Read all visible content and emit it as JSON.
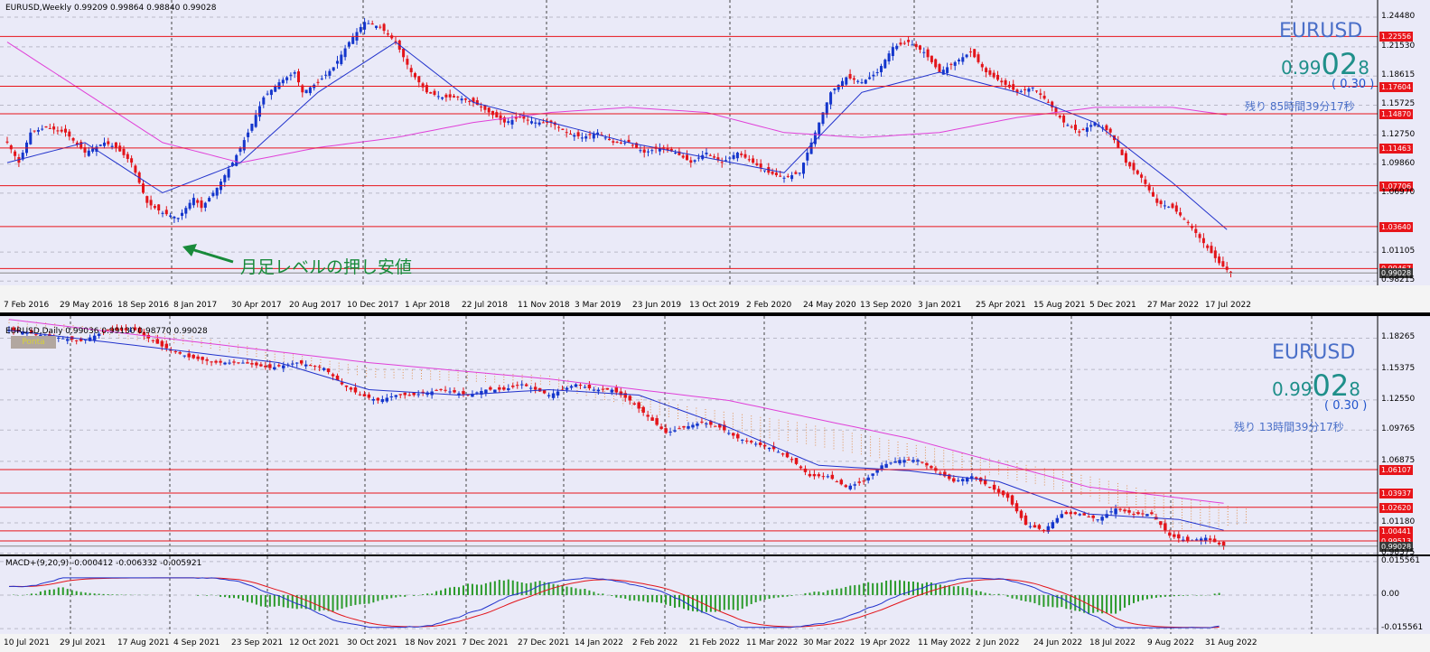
{
  "chart_data": [
    {
      "type": "candlestick",
      "header": "EURUSD,Weekly  0.99209 0.99864 0.98840 0.99028",
      "symbol": "EURUSD",
      "price": {
        "prefix": "0.99",
        "big": "02",
        "suffix": "8"
      },
      "change": "( 0.30 )",
      "remaining": "残り 85時間39分17秒",
      "annotation": "月足レベルの押し安値",
      "ylim": [
        0.9779,
        1.2619
      ],
      "yticks": [
        "1.24480",
        "1.21530",
        "1.18615",
        "1.15725",
        "1.12750",
        "1.09860",
        "1.06970",
        "1.01105",
        "0.98215"
      ],
      "hlines": [
        1.22556,
        1.17604,
        1.1487,
        1.11463,
        1.07706,
        1.0364,
        0.99467
      ],
      "hline_labels": [
        "1.22556",
        "1.17604",
        "1.14870",
        "1.11463",
        "1.07706",
        "1.03640",
        "0.99467"
      ],
      "current_label": "0.99028",
      "current": 0.99028,
      "xlabels": [
        "7 Feb 2016",
        "29 May 2016",
        "18 Sep 2016",
        "8 Jan 2017",
        "30 Apr 2017",
        "20 Aug 2017",
        "10 Dec 2017",
        "1 Apr 2018",
        "22 Jul 2018",
        "11 Nov 2018",
        "3 Mar 2019",
        "23 Jun 2019",
        "13 Oct 2019",
        "2 Feb 2020",
        "24 May 2020",
        "13 Sep 2020",
        "3 Jan 2021",
        "25 Apr 2021",
        "15 Aug 2021",
        "5 Dec 2021",
        "27 Mar 2022",
        "17 Jul 2022"
      ],
      "price_path": [
        [
          0,
          1.12
        ],
        [
          3,
          1.1
        ],
        [
          6,
          1.13
        ],
        [
          10,
          1.135
        ],
        [
          15,
          1.13
        ],
        [
          20,
          1.11
        ],
        [
          25,
          1.12
        ],
        [
          28,
          1.115
        ],
        [
          32,
          1.1
        ],
        [
          36,
          1.06
        ],
        [
          40,
          1.05
        ],
        [
          44,
          1.045
        ],
        [
          48,
          1.065
        ],
        [
          50,
          1.055
        ],
        [
          54,
          1.075
        ],
        [
          58,
          1.1
        ],
        [
          62,
          1.13
        ],
        [
          66,
          1.165
        ],
        [
          70,
          1.18
        ],
        [
          74,
          1.19
        ],
        [
          76,
          1.17
        ],
        [
          80,
          1.18
        ],
        [
          84,
          1.195
        ],
        [
          88,
          1.22
        ],
        [
          92,
          1.24
        ],
        [
          96,
          1.235
        ],
        [
          100,
          1.22
        ],
        [
          104,
          1.19
        ],
        [
          108,
          1.17
        ],
        [
          112,
          1.165
        ],
        [
          116,
          1.165
        ],
        [
          120,
          1.16
        ],
        [
          124,
          1.15
        ],
        [
          128,
          1.14
        ],
        [
          132,
          1.145
        ],
        [
          136,
          1.14
        ],
        [
          140,
          1.14
        ],
        [
          144,
          1.13
        ],
        [
          148,
          1.125
        ],
        [
          152,
          1.13
        ],
        [
          156,
          1.12
        ],
        [
          160,
          1.12
        ],
        [
          164,
          1.11
        ],
        [
          168,
          1.115
        ],
        [
          172,
          1.11
        ],
        [
          176,
          1.1
        ],
        [
          180,
          1.11
        ],
        [
          184,
          1.1
        ],
        [
          188,
          1.11
        ],
        [
          192,
          1.1
        ],
        [
          196,
          1.09
        ],
        [
          200,
          1.085
        ],
        [
          204,
          1.09
        ],
        [
          208,
          1.13
        ],
        [
          212,
          1.17
        ],
        [
          216,
          1.185
        ],
        [
          220,
          1.18
        ],
        [
          224,
          1.19
        ],
        [
          228,
          1.215
        ],
        [
          232,
          1.22
        ],
        [
          236,
          1.21
        ],
        [
          240,
          1.19
        ],
        [
          244,
          1.2
        ],
        [
          248,
          1.21
        ],
        [
          252,
          1.19
        ],
        [
          256,
          1.18
        ],
        [
          260,
          1.17
        ],
        [
          264,
          1.175
        ],
        [
          268,
          1.16
        ],
        [
          272,
          1.14
        ],
        [
          276,
          1.13
        ],
        [
          280,
          1.14
        ],
        [
          284,
          1.13
        ],
        [
          288,
          1.1
        ],
        [
          292,
          1.085
        ],
        [
          296,
          1.06
        ],
        [
          300,
          1.055
        ],
        [
          304,
          1.04
        ],
        [
          308,
          1.02
        ],
        [
          312,
          1.0
        ],
        [
          315,
          0.99
        ]
      ],
      "ma_fast": [
        [
          0,
          1.1
        ],
        [
          20,
          1.12
        ],
        [
          40,
          1.07
        ],
        [
          60,
          1.1
        ],
        [
          80,
          1.17
        ],
        [
          100,
          1.22
        ],
        [
          120,
          1.16
        ],
        [
          140,
          1.14
        ],
        [
          160,
          1.12
        ],
        [
          180,
          1.105
        ],
        [
          200,
          1.09
        ],
        [
          220,
          1.17
        ],
        [
          240,
          1.19
        ],
        [
          260,
          1.17
        ],
        [
          280,
          1.14
        ],
        [
          300,
          1.08
        ],
        [
          315,
          1.03
        ]
      ],
      "ma_slow": [
        [
          0,
          1.22
        ],
        [
          20,
          1.17
        ],
        [
          40,
          1.12
        ],
        [
          60,
          1.1
        ],
        [
          80,
          1.115
        ],
        [
          100,
          1.125
        ],
        [
          120,
          1.14
        ],
        [
          140,
          1.15
        ],
        [
          160,
          1.155
        ],
        [
          180,
          1.15
        ],
        [
          200,
          1.13
        ],
        [
          220,
          1.125
        ],
        [
          240,
          1.13
        ],
        [
          260,
          1.145
        ],
        [
          280,
          1.155
        ],
        [
          300,
          1.155
        ],
        [
          315,
          1.147
        ]
      ]
    },
    {
      "type": "candlestick",
      "header": "EURUSD,Daily  0.99036 0.99130 0.98770 0.99028",
      "badge": "Ponta",
      "symbol": "EURUSD",
      "price": {
        "prefix": "0.99",
        "big": "02",
        "suffix": "8"
      },
      "change": "( 0.30 )",
      "remaining": "残り 13時間39分17秒",
      "ylim": [
        0.9826,
        1.2031
      ],
      "yticks": [
        "1.18265",
        "1.15375",
        "1.12550",
        "1.09765",
        "1.06875",
        "1.01180",
        "0.98375"
      ],
      "hlines": [
        1.06107,
        1.03937,
        1.0262,
        1.00441,
        0.99513
      ],
      "hline_labels": [
        "1.06107",
        "1.03937",
        "1.02620",
        "1.00441",
        "0.99513"
      ],
      "current_label": "0.99028",
      "current": 0.99028,
      "price_path": [
        [
          0,
          1.19
        ],
        [
          8,
          1.185
        ],
        [
          16,
          1.18
        ],
        [
          22,
          1.19
        ],
        [
          28,
          1.19
        ],
        [
          34,
          1.175
        ],
        [
          40,
          1.165
        ],
        [
          46,
          1.16
        ],
        [
          52,
          1.16
        ],
        [
          58,
          1.155
        ],
        [
          64,
          1.16
        ],
        [
          70,
          1.155
        ],
        [
          74,
          1.14
        ],
        [
          78,
          1.13
        ],
        [
          82,
          1.125
        ],
        [
          86,
          1.13
        ],
        [
          90,
          1.13
        ],
        [
          96,
          1.135
        ],
        [
          102,
          1.13
        ],
        [
          106,
          1.135
        ],
        [
          110,
          1.135
        ],
        [
          114,
          1.14
        ],
        [
          120,
          1.13
        ],
        [
          126,
          1.14
        ],
        [
          130,
          1.135
        ],
        [
          134,
          1.135
        ],
        [
          138,
          1.125
        ],
        [
          142,
          1.11
        ],
        [
          146,
          1.095
        ],
        [
          150,
          1.1
        ],
        [
          154,
          1.105
        ],
        [
          158,
          1.1
        ],
        [
          162,
          1.09
        ],
        [
          166,
          1.085
        ],
        [
          170,
          1.08
        ],
        [
          174,
          1.07
        ],
        [
          178,
          1.055
        ],
        [
          182,
          1.055
        ],
        [
          186,
          1.045
        ],
        [
          190,
          1.05
        ],
        [
          194,
          1.065
        ],
        [
          198,
          1.07
        ],
        [
          202,
          1.07
        ],
        [
          206,
          1.06
        ],
        [
          210,
          1.05
        ],
        [
          214,
          1.055
        ],
        [
          218,
          1.045
        ],
        [
          222,
          1.035
        ],
        [
          226,
          1.01
        ],
        [
          230,
          1.005
        ],
        [
          234,
          1.02
        ],
        [
          238,
          1.02
        ],
        [
          242,
          1.015
        ],
        [
          246,
          1.025
        ],
        [
          250,
          1.02
        ],
        [
          254,
          1.02
        ],
        [
          258,
          1.0
        ],
        [
          262,
          0.995
        ],
        [
          266,
          0.998
        ],
        [
          270,
          0.99
        ]
      ],
      "ma_fast": [
        [
          0,
          1.19
        ],
        [
          20,
          1.18
        ],
        [
          40,
          1.17
        ],
        [
          60,
          1.16
        ],
        [
          80,
          1.135
        ],
        [
          100,
          1.13
        ],
        [
          120,
          1.135
        ],
        [
          140,
          1.13
        ],
        [
          160,
          1.1
        ],
        [
          180,
          1.065
        ],
        [
          200,
          1.06
        ],
        [
          220,
          1.05
        ],
        [
          240,
          1.02
        ],
        [
          260,
          1.015
        ],
        [
          270,
          1.005
        ]
      ],
      "ma_slow": [
        [
          0,
          1.2
        ],
        [
          40,
          1.18
        ],
        [
          80,
          1.16
        ],
        [
          120,
          1.145
        ],
        [
          160,
          1.125
        ],
        [
          200,
          1.09
        ],
        [
          240,
          1.045
        ],
        [
          270,
          1.03
        ]
      ],
      "cloud": [
        [
          0,
          1.2,
          1.195
        ],
        [
          40,
          1.185,
          1.175
        ],
        [
          80,
          1.155,
          1.145
        ],
        [
          120,
          1.148,
          1.138
        ],
        [
          150,
          1.12,
          1.105
        ],
        [
          175,
          1.105,
          1.085
        ],
        [
          200,
          1.085,
          1.065
        ],
        [
          220,
          1.07,
          1.055
        ],
        [
          240,
          1.055,
          1.035
        ],
        [
          260,
          1.035,
          1.005
        ],
        [
          275,
          1.025,
          1.01
        ]
      ]
    },
    {
      "type": "line",
      "header": "MACD+(9,20,9) -0.000412 -0.006332 -0.005921",
      "ylim": [
        -0.018,
        0.018
      ],
      "yticks": [
        "0.015561",
        "0.00",
        "-0.015561"
      ],
      "xlabels": [
        "10 Jul 2021",
        "29 Jul 2021",
        "17 Aug 2021",
        "4 Sep 2021",
        "23 Sep 2021",
        "12 Oct 2021",
        "30 Oct 2021",
        "18 Nov 2021",
        "7 Dec 2021",
        "27 Dec 2021",
        "14 Jan 2022",
        "2 Feb 2022",
        "21 Feb 2022",
        "11 Mar 2022",
        "30 Mar 2022",
        "19 Apr 2022",
        "11 May 2022",
        "2 Jun 2022",
        "24 Jun 2022",
        "18 Jul 2022",
        "9 Aug 2022",
        "31 Aug 2022"
      ]
    }
  ]
}
